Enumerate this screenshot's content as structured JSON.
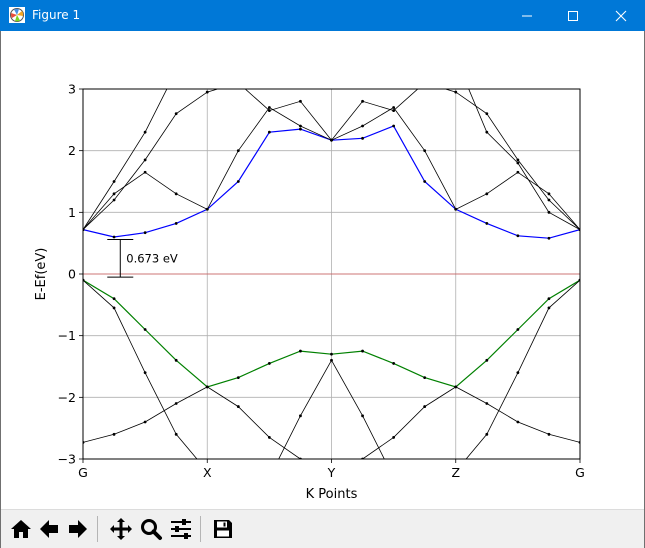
{
  "window": {
    "title": "Figure 1",
    "controls": {
      "minimize": "minimize",
      "maximize": "maximize",
      "close": "close"
    }
  },
  "toolbar": {
    "buttons": [
      {
        "name": "home-button",
        "icon": "home-icon"
      },
      {
        "name": "back-button",
        "icon": "arrow-left-icon"
      },
      {
        "name": "forward-button",
        "icon": "arrow-right-icon"
      },
      {
        "name": "pan-button",
        "icon": "move-icon"
      },
      {
        "name": "zoom-button",
        "icon": "magnifier-icon"
      },
      {
        "name": "configure-subplots-button",
        "icon": "sliders-icon"
      },
      {
        "name": "save-button",
        "icon": "floppy-disk-icon"
      }
    ]
  },
  "chart_data": {
    "type": "line",
    "title": "",
    "xlabel": "K Points",
    "ylabel": "E-Ef(eV)",
    "xlim": [
      0,
      4
    ],
    "ylim": [
      -3,
      3
    ],
    "yticks": [
      -3,
      -2,
      -1,
      0,
      1,
      2,
      3
    ],
    "ytick_labels": [
      "−3",
      "−2",
      "−1",
      "0",
      "1",
      "2",
      "3"
    ],
    "xticks": [
      0,
      1,
      2,
      3,
      4
    ],
    "xtick_labels": [
      "G",
      "X",
      "Y",
      "Z",
      "G"
    ],
    "grid": true,
    "fermi_level": {
      "y": 0,
      "color": "#d62728"
    },
    "gap_annotation": {
      "label": "0.673 eV",
      "x": 0.3,
      "y_bottom": -0.05,
      "y_top": 0.56
    },
    "colors": {
      "conduction": "#0000ff",
      "valence": "#008000",
      "other": "#000000",
      "grid": "#b0b0b0"
    },
    "series": [
      {
        "role": "conduction",
        "x": [
          0,
          0.25,
          0.5,
          0.75,
          1.0,
          1.25,
          1.5,
          1.75,
          2.0,
          2.25,
          2.5,
          2.75,
          3.0,
          3.25,
          3.5,
          3.75,
          4.0
        ],
        "values": [
          0.72,
          0.6,
          0.67,
          0.82,
          1.05,
          1.5,
          2.3,
          2.35,
          2.17,
          2.2,
          2.4,
          1.5,
          1.05,
          0.82,
          0.62,
          0.58,
          0.72
        ]
      },
      {
        "role": "valence",
        "x": [
          0,
          0.25,
          0.5,
          0.75,
          1.0,
          1.25,
          1.5,
          1.75,
          2.0,
          2.25,
          2.5,
          2.75,
          3.0,
          3.25,
          3.5,
          3.75,
          4.0
        ],
        "values": [
          -0.1,
          -0.4,
          -0.9,
          -1.4,
          -1.83,
          -1.68,
          -1.45,
          -1.25,
          -1.3,
          -1.25,
          -1.45,
          -1.68,
          -1.83,
          -1.4,
          -0.9,
          -0.4,
          -0.1
        ]
      },
      {
        "role": "other",
        "x": [
          0,
          0.25,
          0.5,
          0.75,
          1.0,
          1.25,
          1.5,
          1.75,
          2.0,
          2.25,
          2.5,
          2.75,
          3.0,
          3.25,
          3.5,
          3.75,
          4.0
        ],
        "values": [
          -0.1,
          -0.55,
          -1.6,
          -2.6,
          -3.2,
          -3.4,
          -3.3,
          -2.3,
          -1.4,
          -2.3,
          -3.3,
          -3.4,
          -3.2,
          -2.6,
          -1.6,
          -0.55,
          -0.1
        ]
      },
      {
        "role": "other",
        "x": [
          0,
          0.25,
          0.5,
          0.75,
          1.0,
          1.25,
          1.5,
          1.75,
          2.0,
          2.25,
          2.5,
          2.75,
          3.0,
          3.25,
          3.5,
          3.75,
          4.0
        ],
        "values": [
          -2.73,
          -2.6,
          -2.4,
          -2.1,
          -1.83,
          -2.15,
          -2.65,
          -3.0,
          -3.2,
          -3.0,
          -2.65,
          -2.15,
          -1.83,
          -2.1,
          -2.4,
          -2.6,
          -2.73
        ]
      },
      {
        "role": "other",
        "x": [
          0,
          0.25,
          0.5,
          0.75,
          1.0,
          1.25,
          1.5,
          1.75,
          2.0,
          2.25,
          2.5,
          2.75,
          3.0,
          3.25,
          3.5,
          3.75,
          4.0
        ],
        "values": [
          0.72,
          1.3,
          1.65,
          1.3,
          1.05,
          2.0,
          2.7,
          2.4,
          2.17,
          2.4,
          2.7,
          2.0,
          1.05,
          1.3,
          1.65,
          1.3,
          0.72
        ]
      },
      {
        "role": "other",
        "x": [
          0,
          0.25,
          0.5,
          0.75,
          1.0,
          1.25,
          1.5,
          1.75,
          2.0,
          2.25,
          2.5,
          2.75,
          3.0,
          3.25,
          3.5,
          3.75,
          4.0
        ],
        "values": [
          0.72,
          1.2,
          1.85,
          2.6,
          2.95,
          3.1,
          2.65,
          2.8,
          2.17,
          2.8,
          2.65,
          3.1,
          2.95,
          2.6,
          1.85,
          1.2,
          0.72
        ]
      },
      {
        "role": "other",
        "x": [
          0,
          0.25,
          0.5,
          0.75,
          1.0,
          1.25,
          1.5,
          1.75,
          2.0,
          2.25,
          2.5,
          2.75,
          3.0,
          3.25,
          3.5,
          3.75,
          4.0
        ],
        "values": [
          0.72,
          1.5,
          2.3,
          3.3,
          3.5,
          3.4,
          3.1,
          3.3,
          3.4,
          3.3,
          3.1,
          3.4,
          3.5,
          2.3,
          1.8,
          1.0,
          0.72
        ]
      }
    ]
  }
}
